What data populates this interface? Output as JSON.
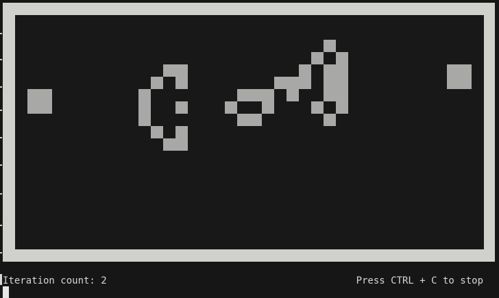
{
  "status": {
    "iteration_label": "Iteration count:",
    "iteration_value": "2",
    "stop_hint": "Press CTRL + C to stop"
  },
  "grid": {
    "columns": 38,
    "rows": 19,
    "alive_color": "#a8a8a6",
    "dead_color": "#181818",
    "border_color": "#d0d0cc",
    "alive_cells": [
      [
        1,
        6
      ],
      [
        2,
        6
      ],
      [
        1,
        7
      ],
      [
        2,
        7
      ],
      [
        12,
        4
      ],
      [
        13,
        4
      ],
      [
        11,
        5
      ],
      [
        13,
        5
      ],
      [
        10,
        6
      ],
      [
        10,
        7
      ],
      [
        13,
        7
      ],
      [
        10,
        8
      ],
      [
        11,
        9
      ],
      [
        13,
        9
      ],
      [
        12,
        10
      ],
      [
        13,
        10
      ],
      [
        17,
        7
      ],
      [
        18,
        6
      ],
      [
        19,
        6
      ],
      [
        20,
        6
      ],
      [
        20,
        7
      ],
      [
        18,
        8
      ],
      [
        19,
        8
      ],
      [
        21,
        5
      ],
      [
        22,
        5
      ],
      [
        22,
        6
      ],
      [
        23,
        4
      ],
      [
        23,
        5
      ],
      [
        24,
        3
      ],
      [
        25,
        2
      ],
      [
        26,
        3
      ],
      [
        24,
        7
      ],
      [
        26,
        7
      ],
      [
        25,
        8
      ],
      [
        25,
        4
      ],
      [
        26,
        4
      ],
      [
        25,
        5
      ],
      [
        26,
        5
      ],
      [
        25,
        6
      ],
      [
        26,
        6
      ],
      [
        35,
        4
      ],
      [
        36,
        4
      ],
      [
        35,
        5
      ],
      [
        36,
        5
      ]
    ]
  }
}
